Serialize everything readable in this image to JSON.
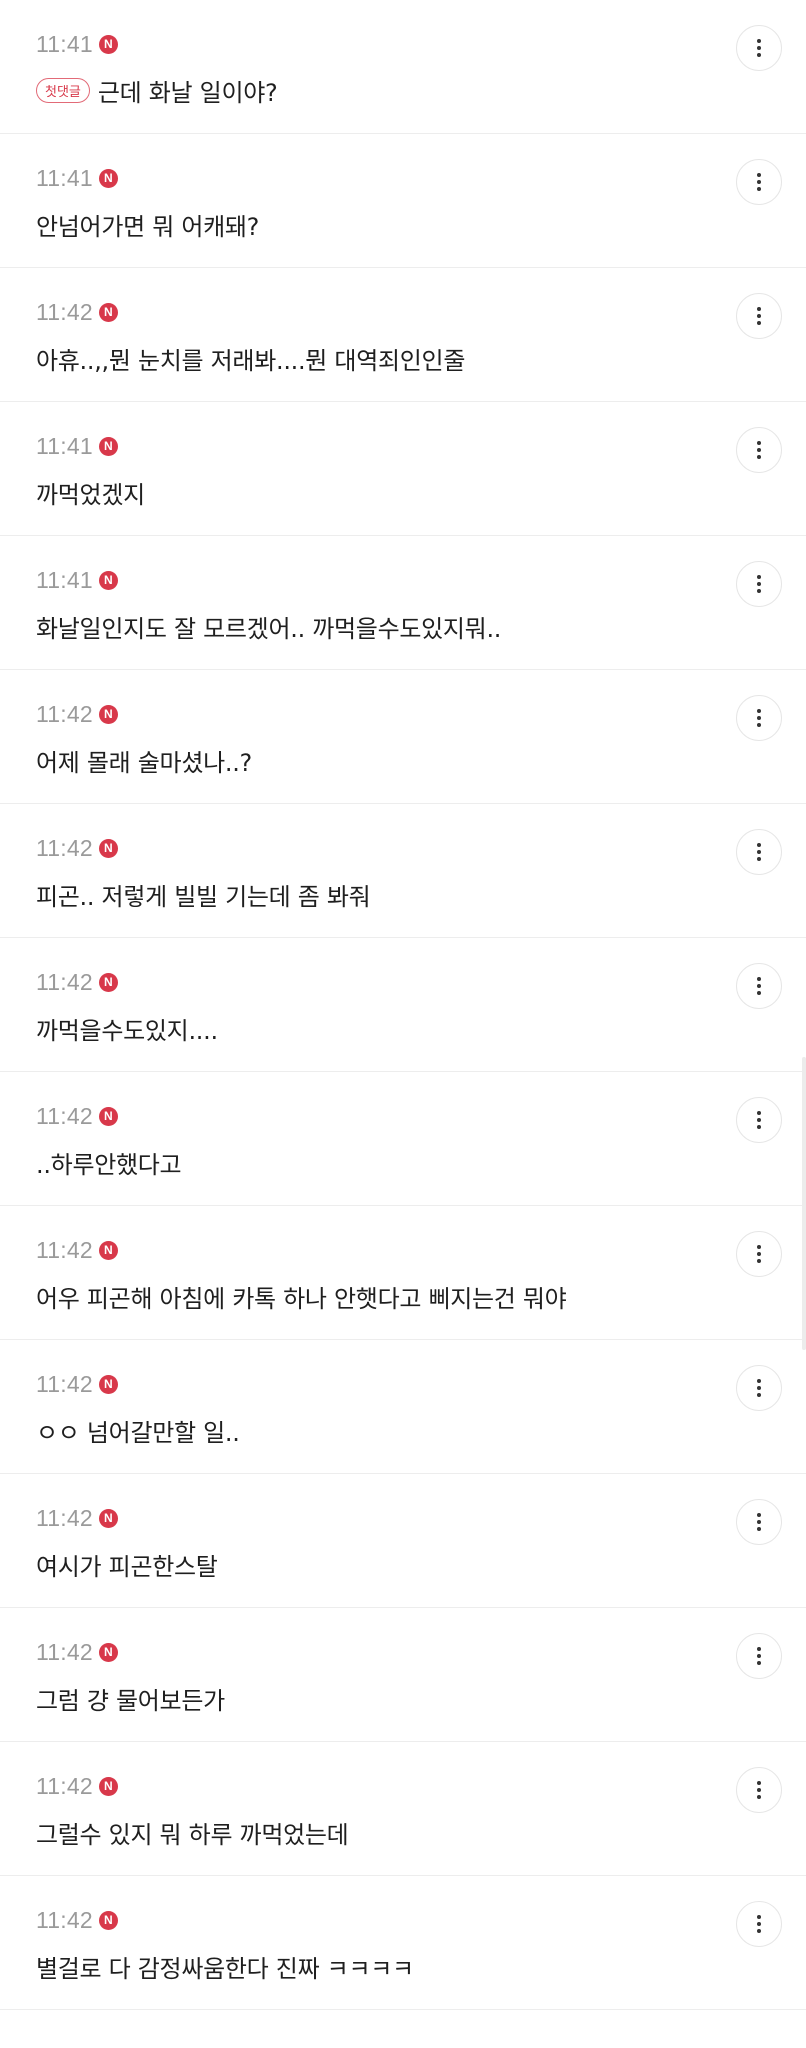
{
  "comments": [
    {
      "time": "11:41",
      "new_badge": "N",
      "first_comment_tag": "첫댓글",
      "text": "근데 화날 일이야?"
    },
    {
      "time": "11:41",
      "new_badge": "N",
      "text": "안넘어가면 뭐 어캐돼?"
    },
    {
      "time": "11:42",
      "new_badge": "N",
      "text": "아휴..,,뭔 눈치를 저래봐....뭔 대역죄인인줄"
    },
    {
      "time": "11:41",
      "new_badge": "N",
      "text": "까먹었겠지"
    },
    {
      "time": "11:41",
      "new_badge": "N",
      "text": "화날일인지도 잘 모르겠어.. 까먹을수도있지뭐.."
    },
    {
      "time": "11:42",
      "new_badge": "N",
      "text": "어제 몰래 술마셨나..?"
    },
    {
      "time": "11:42",
      "new_badge": "N",
      "text": "피곤.. 저렇게 빌빌 기는데 좀 봐줘"
    },
    {
      "time": "11:42",
      "new_badge": "N",
      "text": "까먹을수도있지...."
    },
    {
      "time": "11:42",
      "new_badge": "N",
      "text": "..하루안했다고"
    },
    {
      "time": "11:42",
      "new_badge": "N",
      "text": "어우 피곤해 아침에 카톡 하나 안햇다고 삐지는건 뭐야"
    },
    {
      "time": "11:42",
      "new_badge": "N",
      "text": "ㅇㅇ 넘어갈만할 일.."
    },
    {
      "time": "11:42",
      "new_badge": "N",
      "text": "여시가 피곤한스탈"
    },
    {
      "time": "11:42",
      "new_badge": "N",
      "text": "그럼 걍 물어보든가"
    },
    {
      "time": "11:42",
      "new_badge": "N",
      "text": "그럴수 있지 뭐 하루 까먹었는데"
    },
    {
      "time": "11:42",
      "new_badge": "N",
      "text": "별걸로 다 감정싸움한다 진짜 ㅋㅋㅋㅋ"
    }
  ],
  "more_button_icon": "more-vertical-icon",
  "colors": {
    "accent": "#d8384a",
    "time_text": "#9a9a9a",
    "body_text": "#1f1f1f",
    "divider": "#ededed"
  }
}
